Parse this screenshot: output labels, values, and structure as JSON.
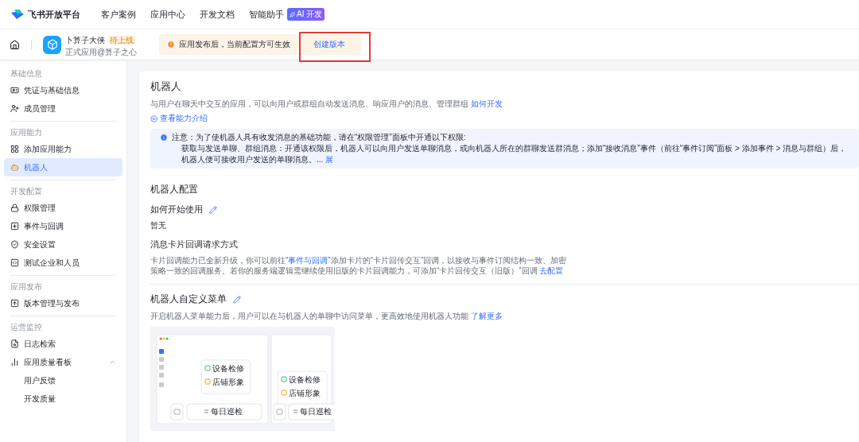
{
  "topnav": {
    "brand": "飞书开放平台",
    "items": [
      "客户案例",
      "应用中心",
      "开发文档",
      "智能助手"
    ],
    "ai_badge": "AI 开发"
  },
  "appbar": {
    "app_name": "卜算子大侠",
    "status": "待上线",
    "subtitle": "正式应用@算子之心",
    "notice": "应用发布后，当前配置方可生效",
    "create_button": {
      "label": "创建版本",
      "highlighted": true
    }
  },
  "sidebar": {
    "groups": [
      {
        "title": "基础信息",
        "items": [
          {
            "label": "凭证与基础信息",
            "selected": false
          },
          {
            "label": "成员管理",
            "selected": false
          }
        ]
      },
      {
        "title": "应用能力",
        "items": [
          {
            "label": "添加应用能力",
            "selected": false
          },
          {
            "label": "机器人",
            "selected": true
          }
        ]
      },
      {
        "title": "开发配置",
        "items": [
          {
            "label": "权限管理",
            "selected": false
          },
          {
            "label": "事件与回调",
            "selected": false
          },
          {
            "label": "安全设置",
            "selected": false
          },
          {
            "label": "测试企业和人员",
            "selected": false
          }
        ]
      },
      {
        "title": "应用发布",
        "items": [
          {
            "label": "版本管理与发布",
            "selected": false
          }
        ]
      },
      {
        "title": "运营监控",
        "items": [
          {
            "label": "日志检索",
            "selected": false
          },
          {
            "label": "应用质量看板",
            "selected": false,
            "expanded": true,
            "children": [
              {
                "label": "用户反馈",
                "selected": false
              },
              {
                "label": "开发质量",
                "selected": false
              }
            ]
          }
        ]
      }
    ]
  },
  "main": {
    "title": "机器人",
    "description": "与用户在聊天中交互的应用，可以向用户或群组自动发送消息、响应用户的消息、管理群组",
    "description_link": "如何开发",
    "intro_link": "查看能力介绍",
    "note": {
      "line_1": "注意：为了使机器人具有收发消息的基础功能，请在“权限管理”面板中开通以下权限:",
      "line_2": "获取与发送单聊、群组消息：开通该权限后，机器人可以向用户发送单聊消息，或向机器人所在的群聊发送群消息；添加“接收消息”事件（前往“事件订阅”面板 > 添加事件 > 消息与群组）后，机器人便可接收用户发送的单聊消息。...",
      "expand_link": "展"
    },
    "config": {
      "title": "机器人配置",
      "usage_title": "如何开始使用",
      "usage_value": "暂无",
      "callback_title": "消息卡片回调请求方式",
      "callback_text_1": "卡片回调能力已全新升级，你可以前往",
      "callback_link": "“事件与回调”",
      "callback_text_2": "添加卡片的“卡片回传交互”回调，以接收与事件订阅结构一致、加密策略一致的回调服务。若你的服务端逻辑需继续使用旧版的卡片回调能力，可添加“卡片回传交互（旧版）”回调",
      "callback_config_link": "去配置"
    },
    "menu": {
      "title": "机器人自定义菜单",
      "description": "开启机器人菜单能力后，用户可以在与机器人的单聊中访问菜单，更高效地使用机器人功能",
      "learn_more": "了解更多",
      "preview": [
        {
          "menu_items": [
            "设备检修",
            "店铺形象"
          ],
          "input_label": "每日巡检"
        },
        {
          "menu_items": [
            "设备检修",
            "店铺形象"
          ],
          "input_label": "每日巡检"
        }
      ]
    }
  }
}
